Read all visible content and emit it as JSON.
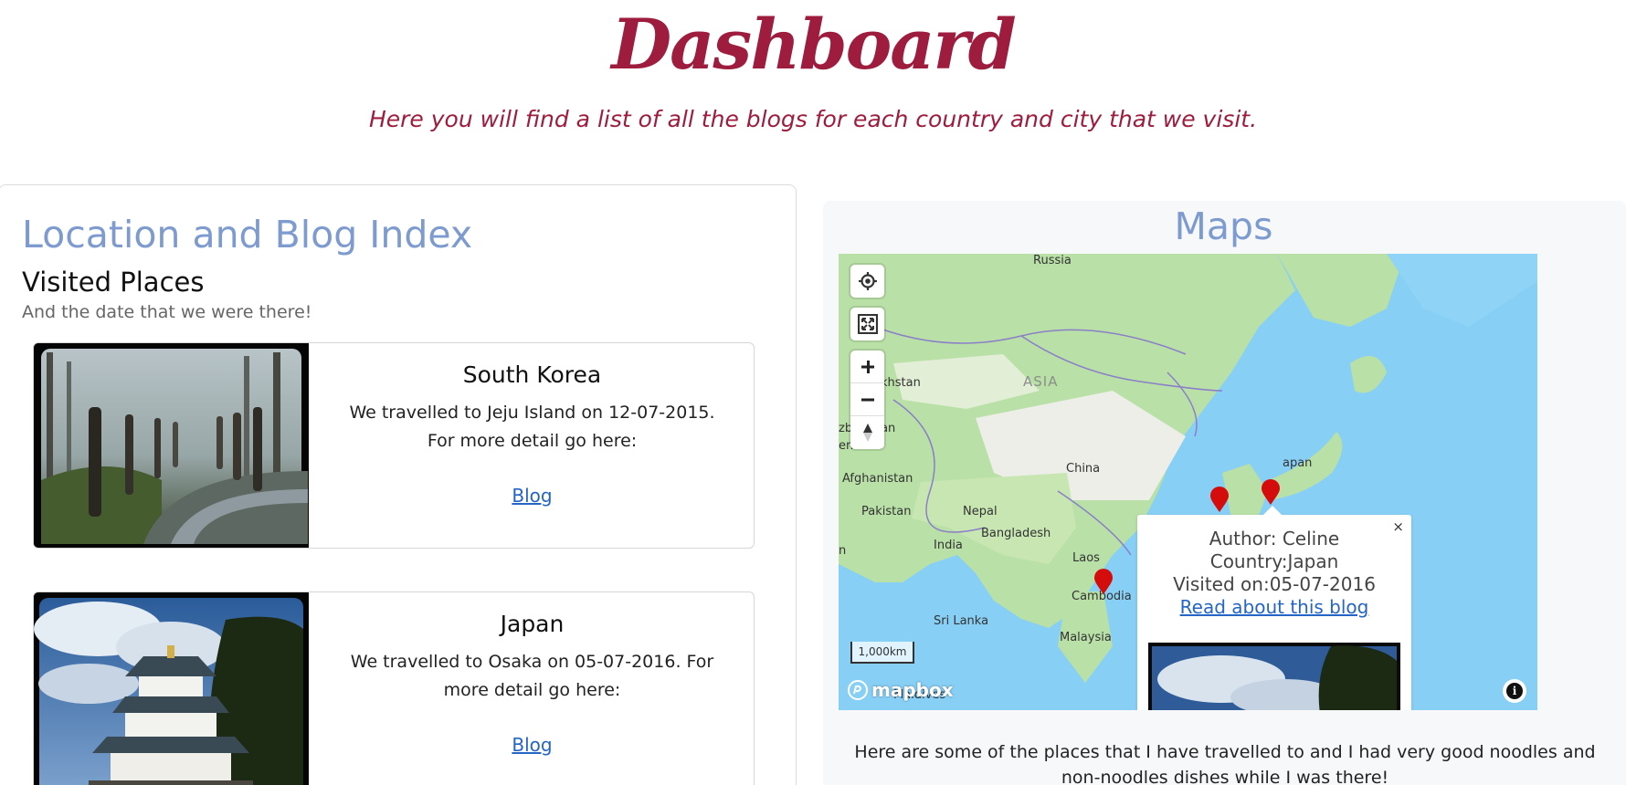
{
  "header": {
    "title": "Dashboard",
    "subtitle": "Here you will find a list of all the blogs for each country and city that we visit."
  },
  "index": {
    "title": "Location and Blog Index",
    "visited_title": "Visited Places",
    "visited_sub": "And the date that we were there!",
    "cards": [
      {
        "title": "South Korea",
        "text": "We travelled to Jeju Island on 12-07-2015. For more detail go here:",
        "link": "Blog"
      },
      {
        "title": "Japan",
        "text": "We travelled to Osaka on 05-07-2016. For more detail go here:",
        "link": "Blog"
      }
    ]
  },
  "maps": {
    "title": "Maps",
    "labels": {
      "russia": "Russia",
      "kazakhstan": "khstan",
      "asia": "ASIA",
      "uzbekistan": "zbekistan",
      "turkmenistan": "enistan",
      "afghanistan": "Afghanistan",
      "china": "China",
      "japan": "apan",
      "pakistan": "Pakistan",
      "nepal": "Nepal",
      "bangladesh": "Bangladesh",
      "india": "India",
      "laos": "Laos",
      "cambodia": "Cambodia",
      "srilanka": "Sri Lanka",
      "malaysia": "Malaysia",
      "maldives": "Maldives",
      "partial_n": "n"
    },
    "scale": "1,000km",
    "logo": "mapbox",
    "popup": {
      "author": "Author: Celine",
      "country": "Country:Japan",
      "visited": "Visited on:05-07-2016",
      "link": "Read about this blog",
      "close": "×"
    },
    "caption": "Here are some of the places that I have travelled to and I had very good noodles and non-noodles dishes while I was there!",
    "marker_color": "#d40c0c"
  },
  "colors": {
    "accent": "#9e1c3d",
    "heading_blue": "#7e9bd0",
    "link": "#2465c6"
  }
}
